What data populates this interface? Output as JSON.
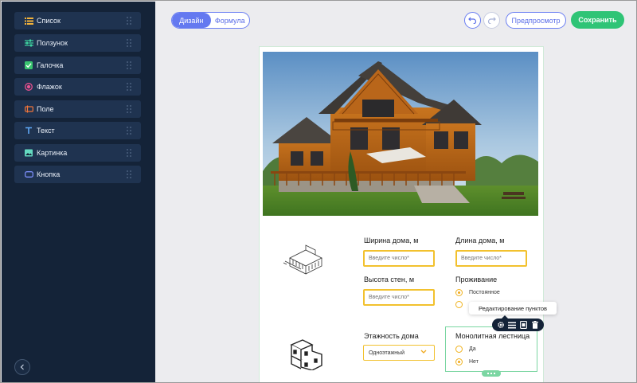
{
  "sidebar": {
    "items": [
      {
        "label": "Список",
        "icon": "list-icon"
      },
      {
        "label": "Ползунок",
        "icon": "slider-icon"
      },
      {
        "label": "Галочка",
        "icon": "checkbox-icon"
      },
      {
        "label": "Флажок",
        "icon": "radio-icon"
      },
      {
        "label": "Поле",
        "icon": "input-field-icon"
      },
      {
        "label": "Текст",
        "icon": "text-icon"
      },
      {
        "label": "Картинка",
        "icon": "image-icon"
      },
      {
        "label": "Кнопка",
        "icon": "button-icon"
      }
    ],
    "collapse_icon": "chevron-left-icon"
  },
  "toolbar": {
    "tabs": [
      {
        "label": "Дизайн",
        "active": true
      },
      {
        "label": "Формула",
        "active": false
      }
    ],
    "undo_icon": "undo-icon",
    "redo_icon": "redo-icon",
    "preview_label": "Предпросмотр",
    "save_label": "Сохранить"
  },
  "form": {
    "house_width": {
      "label": "Ширина дома, м",
      "placeholder": "Введите число*"
    },
    "house_length": {
      "label": "Длина дома, м",
      "placeholder": "Введите число*"
    },
    "wall_height": {
      "label": "Высота стен, м",
      "placeholder": "Введите число*"
    },
    "residence": {
      "label": "Проживание",
      "options": [
        {
          "label": "Постоянное",
          "checked": true
        },
        {
          "label": "",
          "checked": false
        }
      ]
    },
    "floors": {
      "label": "Этажность дома",
      "value": "Одноэтажный"
    },
    "monolithic_stairs": {
      "label": "Монолитная лестница",
      "options": [
        {
          "label": "Да",
          "checked": false
        },
        {
          "label": "Нет",
          "checked": true
        }
      ]
    }
  },
  "tooltip": {
    "text": "Редактирование пунктов"
  },
  "action_bar": {
    "icons": [
      "gear-icon",
      "list-icon",
      "copy-icon",
      "trash-icon"
    ]
  },
  "colors": {
    "sidebar_bg": "#142338",
    "accent": "#6479f0",
    "save_green": "#2fc476",
    "input_border": "#f2c12e",
    "selection_green": "#7bd6a2"
  }
}
